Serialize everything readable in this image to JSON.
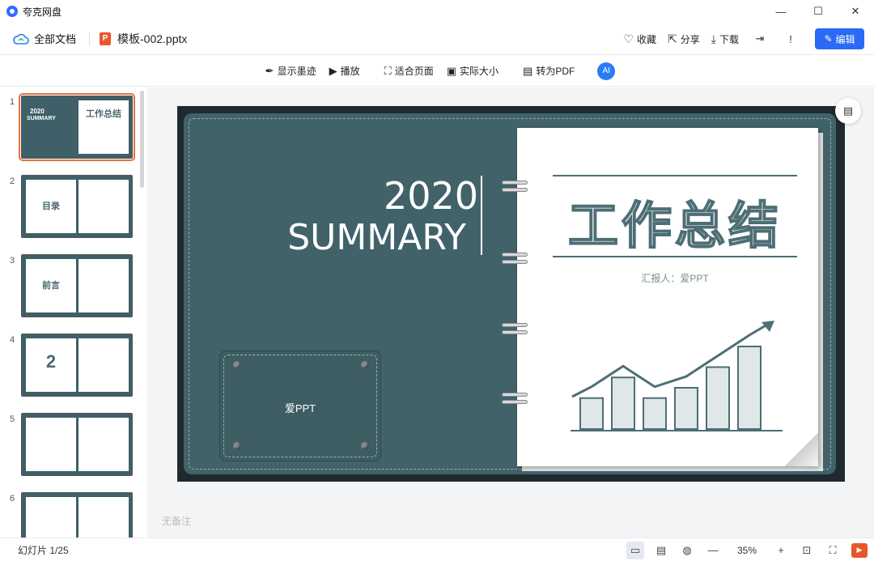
{
  "app": {
    "name": "夸克网盘"
  },
  "window": {
    "minimize": "—",
    "maximize": "☐",
    "close": "✕"
  },
  "header": {
    "all_docs": "全部文档",
    "file_icon_text": "P",
    "file_name": "模板-002.pptx",
    "actions": [
      {
        "icon": "heart-icon",
        "glyph": "♡",
        "label": "收藏"
      },
      {
        "icon": "share-icon",
        "glyph": "⇱",
        "label": "分享"
      },
      {
        "icon": "download-icon",
        "glyph": "⤓",
        "label": "下载"
      }
    ],
    "icon_buttons": [
      {
        "icon": "export-icon",
        "glyph": "⇥"
      },
      {
        "icon": "feedback-icon",
        "glyph": "!"
      }
    ],
    "edit_label": "编辑",
    "edit_glyph": "✎"
  },
  "toolbar": {
    "items": [
      {
        "icon": "ink-icon",
        "glyph": "✒",
        "label": "显示墨迹"
      },
      {
        "icon": "play-circle-icon",
        "glyph": "▶",
        "label": "播放"
      },
      {
        "icon": "fit-page-icon",
        "glyph": "⛶",
        "label": "适合页面"
      },
      {
        "icon": "actual-size-icon",
        "glyph": "▣",
        "label": "实际大小"
      },
      {
        "icon": "pdf-icon",
        "glyph": "▤",
        "label": "转为PDF"
      }
    ],
    "ai_label": "AI"
  },
  "thumbnails": [
    {
      "num": "1",
      "active": true
    },
    {
      "num": "2",
      "active": false,
      "text": "目录"
    },
    {
      "num": "3",
      "active": false,
      "text": "前言"
    },
    {
      "num": "4",
      "active": false,
      "text": "2"
    },
    {
      "num": "5",
      "active": false
    },
    {
      "num": "6",
      "active": false
    }
  ],
  "slide": {
    "year": "2020",
    "summary": "SUMMARY",
    "title": "工作总结",
    "reporter": "汇报人：爱PPT",
    "pocket_text": "爱PPT",
    "chart_bars": [
      3,
      5,
      3,
      4,
      6,
      8
    ]
  },
  "notes": "无备注",
  "status": {
    "slide_count": "幻灯片 1/25",
    "zoom": "35%"
  }
}
